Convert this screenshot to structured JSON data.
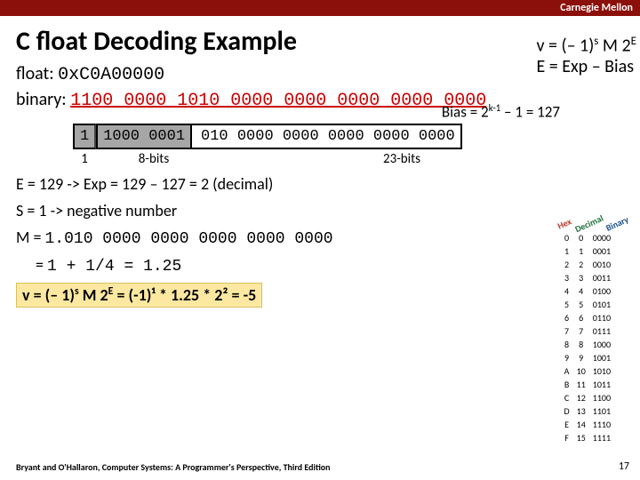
{
  "header": {
    "brand": "Carnegie Mellon"
  },
  "title": "C float Decoding Example",
  "formula": {
    "line1_pre": "v = (– 1)",
    "line1_s": "s",
    "line1_mid": " M 2",
    "line1_e": "E",
    "line2": "E  =  Exp – Bias"
  },
  "float_label": "float: ",
  "float_value": "0xC0A00000",
  "bias": {
    "pre": "Bias = 2",
    "exp": "k-1",
    "post": " – 1 = 127"
  },
  "binary_label": "binary: ",
  "binary_value": "1100 0000 1010 0000 0000 0000 0000 0000",
  "fields": {
    "sign": "1",
    "exponent": "1000 0001",
    "mantissa": "010 0000 0000 0000 0000 0000"
  },
  "field_labels": {
    "sign": "1",
    "exp": "8-bits",
    "mant": "23-bits"
  },
  "steps": {
    "e": "E = 129 -> Exp = 129 – 127 = 2 (decimal)",
    "s": "S = 1 -> negative number",
    "m1_pre": "M = ",
    "m1_val": "1.010 0000 0000 0000 0000 0000",
    "m2_pre": "   = ",
    "m2_val": "1 + 1/4 = 1.25"
  },
  "result": {
    "lhs_pre": "v = (– 1)",
    "lhs_s": "s",
    "lhs_mid": " M 2",
    "lhs_e": "E",
    "rhs": " = (-1)¹ * 1.25 * 2² = -5"
  },
  "hextbl": {
    "h": [
      "0",
      "1",
      "2",
      "3",
      "4",
      "5",
      "6",
      "7",
      "8",
      "9",
      "A",
      "B",
      "C",
      "D",
      "E",
      "F"
    ],
    "d": [
      "0",
      "1",
      "2",
      "3",
      "4",
      "5",
      "6",
      "7",
      "8",
      "9",
      "10",
      "11",
      "12",
      "13",
      "14",
      "15"
    ],
    "b": [
      "0000",
      "0001",
      "0010",
      "0011",
      "0100",
      "0101",
      "0110",
      "0111",
      "1000",
      "1001",
      "1010",
      "1011",
      "1100",
      "1101",
      "1110",
      "1111"
    ],
    "hdr_hex": "Hex",
    "hdr_dec": "Decimal",
    "hdr_bin": "Binary"
  },
  "footer": "Bryant and O'Hallaron, Computer Systems: A Programmer's Perspective, Third Edition",
  "page": "17"
}
